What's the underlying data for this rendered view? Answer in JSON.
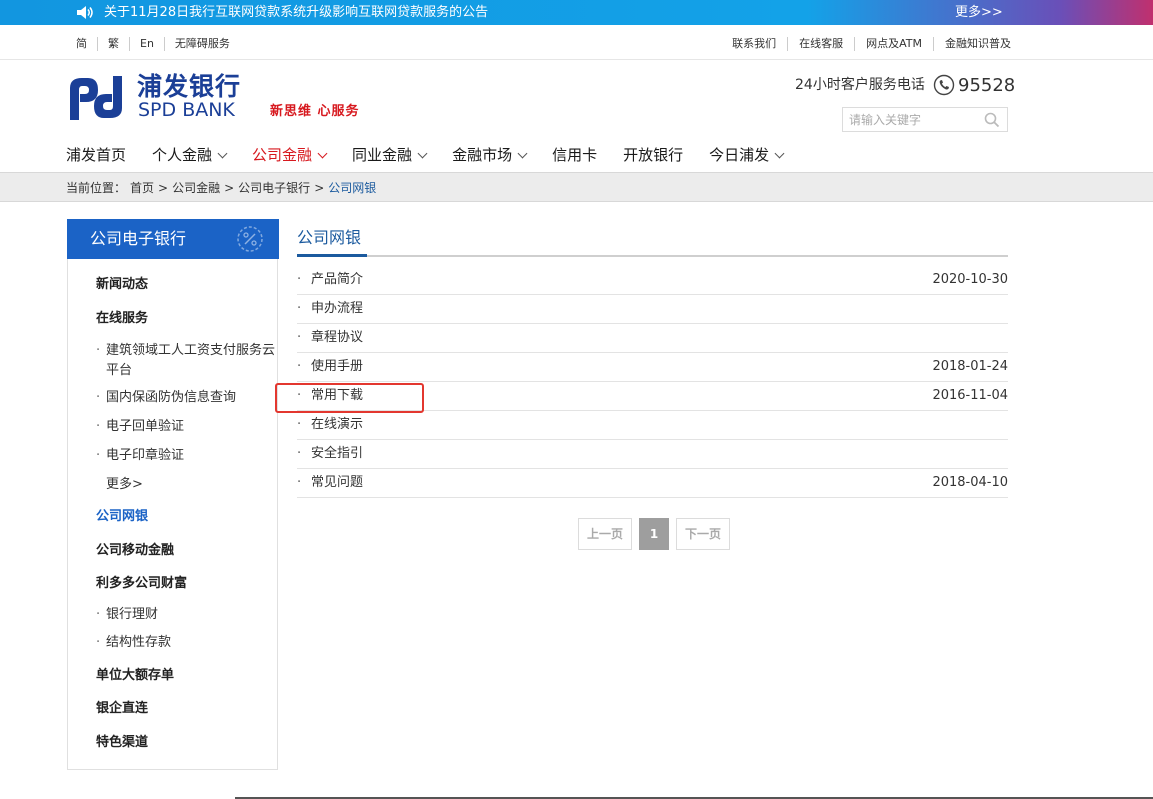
{
  "notice": {
    "text": "关于11月28日我行互联网贷款系统升级影响互联网贷款服务的公告",
    "more": "更多>>"
  },
  "utility": {
    "lang_links": [
      "简",
      "繁",
      "En",
      "无障碍服务"
    ],
    "top_links": [
      "联系我们",
      "在线客服",
      "网点及ATM",
      "金融知识普及"
    ]
  },
  "header": {
    "logo_cn": "浦发银行",
    "logo_en": "SPD BANK",
    "slogan": "新思维  心服务",
    "hotline_label": "24小时客户服务电话",
    "hotline_number": "95528",
    "search_placeholder": "请输入关键字"
  },
  "nav": {
    "items": [
      {
        "label": "浦发首页",
        "dropdown": false
      },
      {
        "label": "个人金融",
        "dropdown": true
      },
      {
        "label": "公司金融",
        "dropdown": true,
        "active": true
      },
      {
        "label": "同业金融",
        "dropdown": true
      },
      {
        "label": "金融市场",
        "dropdown": true
      },
      {
        "label": "信用卡",
        "dropdown": false
      },
      {
        "label": "开放银行",
        "dropdown": false
      },
      {
        "label": "今日浦发",
        "dropdown": true
      }
    ]
  },
  "breadcrumb": {
    "label": "当前位置：",
    "items": [
      "首页",
      "公司金融",
      "公司电子银行"
    ],
    "separator": ">",
    "current": "公司网银"
  },
  "sidebar": {
    "title": "公司电子银行",
    "items": [
      {
        "label": "新闻动态",
        "type": "section"
      },
      {
        "label": "在线服务",
        "type": "section"
      },
      {
        "label": "建筑领域工人工资支付服务云平台",
        "type": "sub"
      },
      {
        "label": "国内保函防伪信息查询",
        "type": "sub"
      },
      {
        "label": "电子回单验证",
        "type": "sub"
      },
      {
        "label": "电子印章验证",
        "type": "sub"
      },
      {
        "label": "更多>",
        "type": "more"
      },
      {
        "label": "公司网银",
        "type": "section",
        "active": true
      },
      {
        "label": "公司移动金融",
        "type": "section"
      },
      {
        "label": "利多多公司财富",
        "type": "section"
      },
      {
        "label": "银行理财",
        "type": "sub"
      },
      {
        "label": "结构性存款",
        "type": "sub"
      },
      {
        "label": "单位大额存单",
        "type": "section"
      },
      {
        "label": "银企直连",
        "type": "section"
      },
      {
        "label": "特色渠道",
        "type": "section"
      }
    ]
  },
  "content": {
    "title": "公司网银",
    "bullet": "·",
    "rows": [
      {
        "title": "产品简介",
        "date": "2020-10-30"
      },
      {
        "title": "申办流程",
        "date": ""
      },
      {
        "title": "章程协议",
        "date": ""
      },
      {
        "title": "使用手册",
        "date": "2018-01-24"
      },
      {
        "title": "常用下载",
        "date": "2016-11-04"
      },
      {
        "title": "在线演示",
        "date": ""
      },
      {
        "title": "安全指引",
        "date": ""
      },
      {
        "title": "常见问题",
        "date": "2018-04-10"
      }
    ]
  },
  "pager": {
    "prev": "上一页",
    "current": "1",
    "next": "下一页"
  },
  "colors": {
    "brand_blue": "#1b3f97",
    "sidebar_blue": "#1b63c6",
    "active_red": "#d7191f",
    "highlight_red": "#e3372f"
  }
}
